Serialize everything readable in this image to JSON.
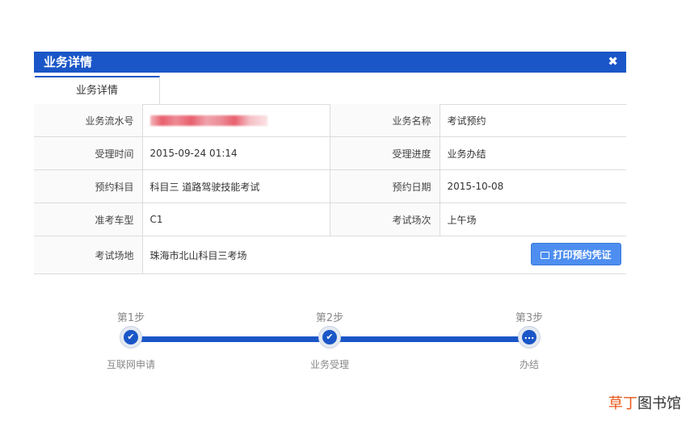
{
  "dialog": {
    "title": "业务详情",
    "close_icon": "close-icon",
    "tab": "业务详情"
  },
  "details": {
    "serial_label": "业务流水号",
    "serial_value": "",
    "name_label": "业务名称",
    "name_value": "考试预约",
    "time_label": "受理时间",
    "time_value": "2015-09-24 01:14",
    "progress_label": "受理进度",
    "progress_value": "业务办结",
    "subject_label": "预约科目",
    "subject_value": "科目三 道路驾驶技能考试",
    "date_label": "预约日期",
    "date_value": "2015-10-08",
    "vehicle_label": "准考车型",
    "vehicle_value": "C1",
    "session_label": "考试场次",
    "session_value": "上午场",
    "venue_label": "考试场地",
    "venue_value": "珠海市北山科目三考场"
  },
  "print_button": {
    "label": "打印预约凭证",
    "icon": "printer-icon"
  },
  "steps": [
    {
      "title": "第1步",
      "desc": "互联网申请",
      "mark": "✔"
    },
    {
      "title": "第2步",
      "desc": "业务受理",
      "mark": "✔"
    },
    {
      "title": "第3步",
      "desc": "办结",
      "mark": "..."
    }
  ],
  "watermark": {
    "accent": "草丁",
    "rest": "图书馆"
  },
  "colors": {
    "primary": "#1a56c7",
    "button": "#4d8ef0",
    "watermark_accent": "#e8581a"
  }
}
